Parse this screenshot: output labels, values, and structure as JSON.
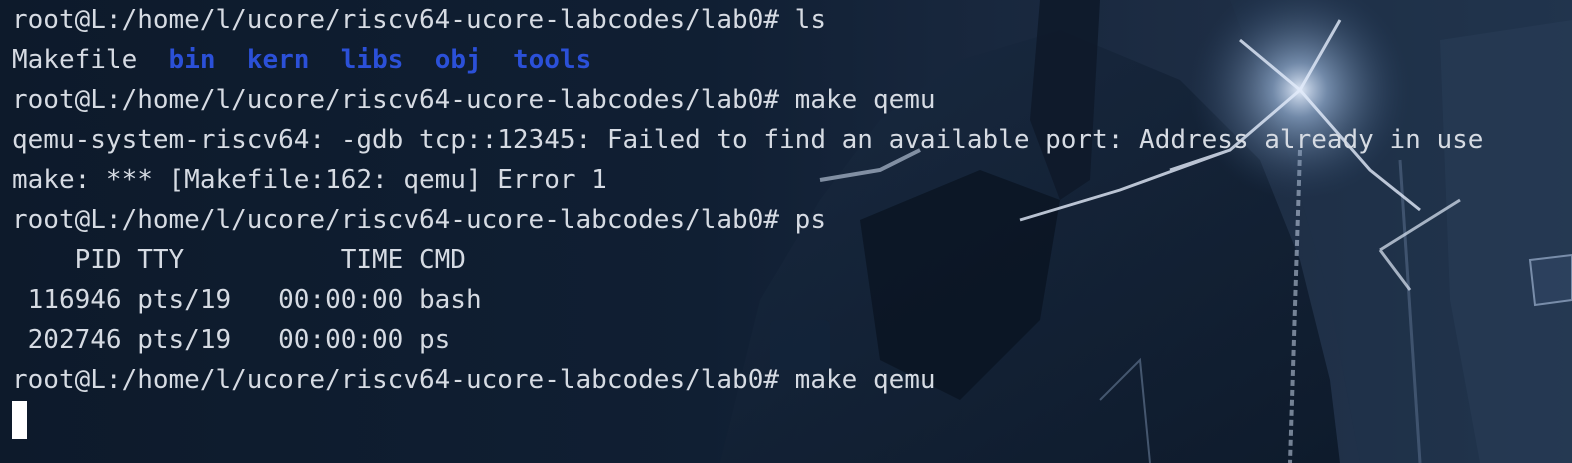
{
  "terminal": {
    "colors": {
      "background": "#0f1d30",
      "text": "#d6dbe3",
      "directory": "#2b50d8",
      "cursor": "#ffffff"
    },
    "lines": [
      {
        "prompt": "root@L:/home/l/ucore/riscv64-ucore-labcodes/lab0#",
        "command": "ls"
      },
      {
        "file": "Makefile",
        "dirs": [
          "bin",
          "kern",
          "libs",
          "obj",
          "tools"
        ]
      },
      {
        "prompt": "root@L:/home/l/ucore/riscv64-ucore-labcodes/lab0#",
        "command": "make qemu"
      },
      {
        "text": "qemu-system-riscv64: -gdb tcp::12345: Failed to find an available port: Address already in use"
      },
      {
        "text": "make: *** [Makefile:162: qemu] Error 1"
      },
      {
        "prompt": "root@L:/home/l/ucore/riscv64-ucore-labcodes/lab0#",
        "command": "ps"
      },
      {
        "text": "    PID TTY          TIME CMD"
      },
      {
        "text": " 116946 pts/19   00:00:00 bash"
      },
      {
        "text": " 202746 pts/19   00:00:00 ps"
      },
      {
        "prompt": "root@L:/home/l/ucore/riscv64-ucore-labcodes/lab0#",
        "command": "make qemu"
      }
    ]
  }
}
